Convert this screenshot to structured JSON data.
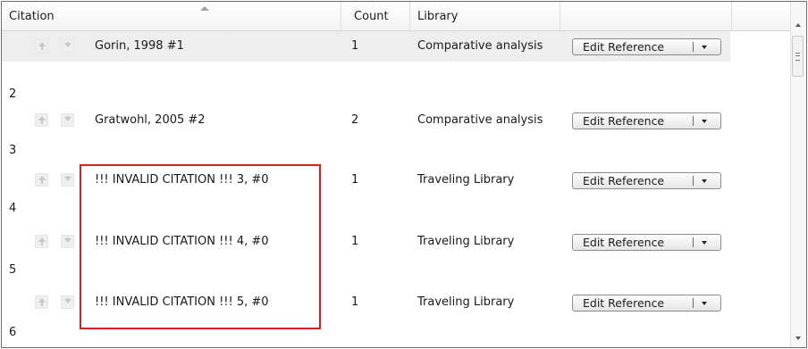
{
  "header": {
    "citation": "Citation",
    "count": "Count",
    "library": "Library"
  },
  "rows": [
    {
      "number": "",
      "citation": "Gorin, 1998 #1",
      "count": "1",
      "library": "Comparative analysis",
      "button": "Edit Reference"
    },
    {
      "number": "2",
      "citation": "Gratwohl, 2005 #2",
      "count": "2",
      "library": "Comparative analysis",
      "button": "Edit Reference"
    },
    {
      "number": "3",
      "citation": "!!! INVALID CITATION !!! 3,  #0",
      "count": "1",
      "library": "Traveling Library",
      "button": "Edit Reference"
    },
    {
      "number": "4",
      "citation": "!!! INVALID CITATION !!! 4,  #0",
      "count": "1",
      "library": "Traveling Library",
      "button": "Edit Reference"
    },
    {
      "number": "5",
      "citation": "!!! INVALID CITATION !!! 5,  #0",
      "count": "1",
      "library": "Traveling Library",
      "button": "Edit Reference"
    }
  ],
  "trailing_number": "6",
  "icons": {
    "move_up": "up-arrow-icon",
    "move_down": "down-arrow-icon",
    "dropdown": "chevron-down-icon",
    "sort": "sort-ascending-icon"
  },
  "colors": {
    "highlight_border": "#d61f1f",
    "selected_row": "#eeeeee"
  }
}
